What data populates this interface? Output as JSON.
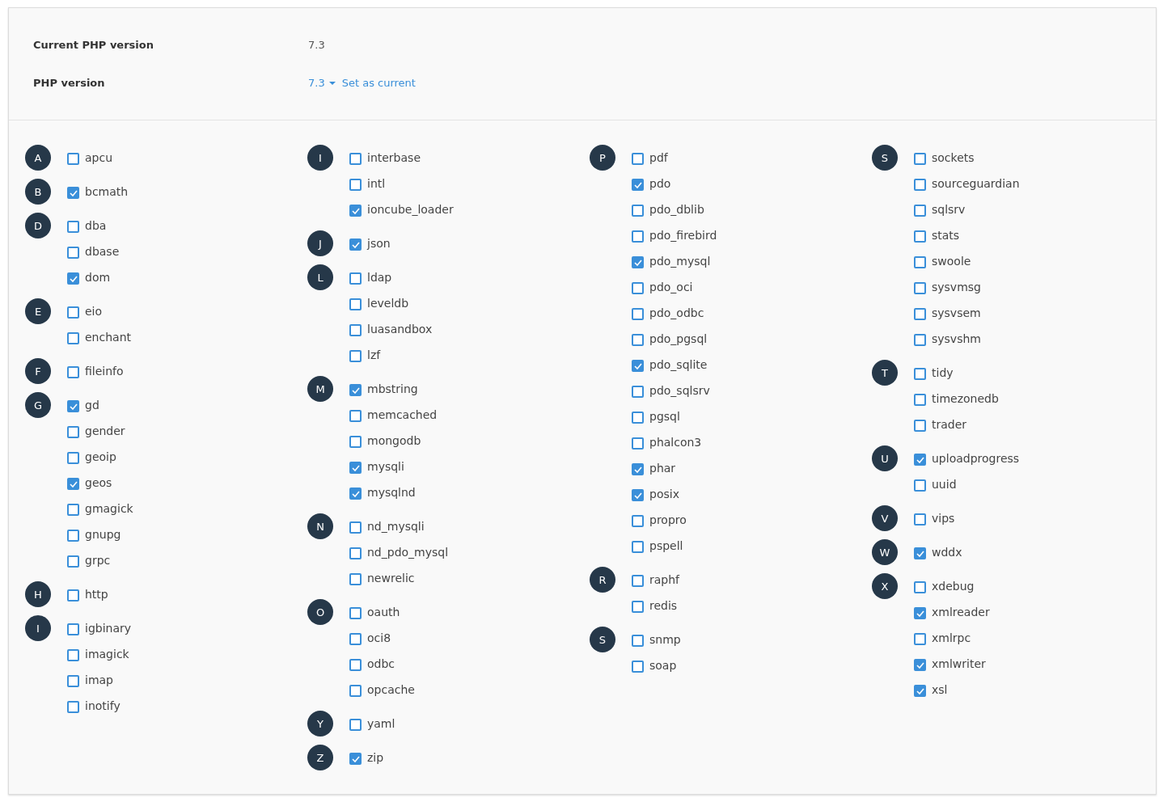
{
  "header": {
    "current_label": "Current PHP version",
    "current_value": "7.3",
    "version_label": "PHP version",
    "version_select": "7.3",
    "set_current_link": "Set as current"
  },
  "columns": [
    [
      {
        "letter": "A",
        "items": [
          {
            "name": "apcu",
            "checked": false
          }
        ]
      },
      {
        "letter": "B",
        "items": [
          {
            "name": "bcmath",
            "checked": true
          }
        ]
      },
      {
        "letter": "D",
        "items": [
          {
            "name": "dba",
            "checked": false
          },
          {
            "name": "dbase",
            "checked": false
          },
          {
            "name": "dom",
            "checked": true
          }
        ]
      },
      {
        "letter": "E",
        "items": [
          {
            "name": "eio",
            "checked": false
          },
          {
            "name": "enchant",
            "checked": false
          }
        ]
      },
      {
        "letter": "F",
        "items": [
          {
            "name": "fileinfo",
            "checked": false
          }
        ]
      },
      {
        "letter": "G",
        "items": [
          {
            "name": "gd",
            "checked": true
          },
          {
            "name": "gender",
            "checked": false
          },
          {
            "name": "geoip",
            "checked": false
          },
          {
            "name": "geos",
            "checked": true
          },
          {
            "name": "gmagick",
            "checked": false
          },
          {
            "name": "gnupg",
            "checked": false
          },
          {
            "name": "grpc",
            "checked": false
          }
        ]
      },
      {
        "letter": "H",
        "items": [
          {
            "name": "http",
            "checked": false
          }
        ]
      },
      {
        "letter": "I",
        "items": [
          {
            "name": "igbinary",
            "checked": false
          },
          {
            "name": "imagick",
            "checked": false
          },
          {
            "name": "imap",
            "checked": false
          },
          {
            "name": "inotify",
            "checked": false
          }
        ]
      }
    ],
    [
      {
        "letter": "I",
        "items": [
          {
            "name": "interbase",
            "checked": false
          },
          {
            "name": "intl",
            "checked": false
          },
          {
            "name": "ioncube_loader",
            "checked": true
          }
        ]
      },
      {
        "letter": "J",
        "items": [
          {
            "name": "json",
            "checked": true
          }
        ]
      },
      {
        "letter": "L",
        "items": [
          {
            "name": "ldap",
            "checked": false
          },
          {
            "name": "leveldb",
            "checked": false
          },
          {
            "name": "luasandbox",
            "checked": false
          },
          {
            "name": "lzf",
            "checked": false
          }
        ]
      },
      {
        "letter": "M",
        "items": [
          {
            "name": "mbstring",
            "checked": true
          },
          {
            "name": "memcached",
            "checked": false
          },
          {
            "name": "mongodb",
            "checked": false
          },
          {
            "name": "mysqli",
            "checked": true
          },
          {
            "name": "mysqlnd",
            "checked": true
          }
        ]
      },
      {
        "letter": "N",
        "items": [
          {
            "name": "nd_mysqli",
            "checked": false
          },
          {
            "name": "nd_pdo_mysql",
            "checked": false
          },
          {
            "name": "newrelic",
            "checked": false
          }
        ]
      },
      {
        "letter": "O",
        "items": [
          {
            "name": "oauth",
            "checked": false
          },
          {
            "name": "oci8",
            "checked": false
          },
          {
            "name": "odbc",
            "checked": false
          },
          {
            "name": "opcache",
            "checked": false
          }
        ]
      },
      {
        "letter": "Y",
        "items": [
          {
            "name": "yaml",
            "checked": false
          }
        ]
      },
      {
        "letter": "Z",
        "items": [
          {
            "name": "zip",
            "checked": true
          }
        ]
      }
    ],
    [
      {
        "letter": "P",
        "items": [
          {
            "name": "pdf",
            "checked": false
          },
          {
            "name": "pdo",
            "checked": true
          },
          {
            "name": "pdo_dblib",
            "checked": false
          },
          {
            "name": "pdo_firebird",
            "checked": false
          },
          {
            "name": "pdo_mysql",
            "checked": true
          },
          {
            "name": "pdo_oci",
            "checked": false
          },
          {
            "name": "pdo_odbc",
            "checked": false
          },
          {
            "name": "pdo_pgsql",
            "checked": false
          },
          {
            "name": "pdo_sqlite",
            "checked": true
          },
          {
            "name": "pdo_sqlsrv",
            "checked": false
          },
          {
            "name": "pgsql",
            "checked": false
          },
          {
            "name": "phalcon3",
            "checked": false
          },
          {
            "name": "phar",
            "checked": true
          },
          {
            "name": "posix",
            "checked": true
          },
          {
            "name": "propro",
            "checked": false
          },
          {
            "name": "pspell",
            "checked": false
          }
        ]
      },
      {
        "letter": "R",
        "items": [
          {
            "name": "raphf",
            "checked": false
          },
          {
            "name": "redis",
            "checked": false
          }
        ]
      },
      {
        "letter": "S",
        "items": [
          {
            "name": "snmp",
            "checked": false
          },
          {
            "name": "soap",
            "checked": false
          }
        ]
      }
    ],
    [
      {
        "letter": "S",
        "items": [
          {
            "name": "sockets",
            "checked": false
          },
          {
            "name": "sourceguardian",
            "checked": false
          },
          {
            "name": "sqlsrv",
            "checked": false
          },
          {
            "name": "stats",
            "checked": false
          },
          {
            "name": "swoole",
            "checked": false
          },
          {
            "name": "sysvmsg",
            "checked": false
          },
          {
            "name": "sysvsem",
            "checked": false
          },
          {
            "name": "sysvshm",
            "checked": false
          }
        ]
      },
      {
        "letter": "T",
        "items": [
          {
            "name": "tidy",
            "checked": false
          },
          {
            "name": "timezonedb",
            "checked": false
          },
          {
            "name": "trader",
            "checked": false
          }
        ]
      },
      {
        "letter": "U",
        "items": [
          {
            "name": "uploadprogress",
            "checked": true
          },
          {
            "name": "uuid",
            "checked": false
          }
        ]
      },
      {
        "letter": "V",
        "items": [
          {
            "name": "vips",
            "checked": false
          }
        ]
      },
      {
        "letter": "W",
        "items": [
          {
            "name": "wddx",
            "checked": true
          }
        ]
      },
      {
        "letter": "X",
        "items": [
          {
            "name": "xdebug",
            "checked": false
          },
          {
            "name": "xmlreader",
            "checked": true
          },
          {
            "name": "xmlrpc",
            "checked": false
          },
          {
            "name": "xmlwriter",
            "checked": true
          },
          {
            "name": "xsl",
            "checked": true
          }
        ]
      }
    ]
  ]
}
